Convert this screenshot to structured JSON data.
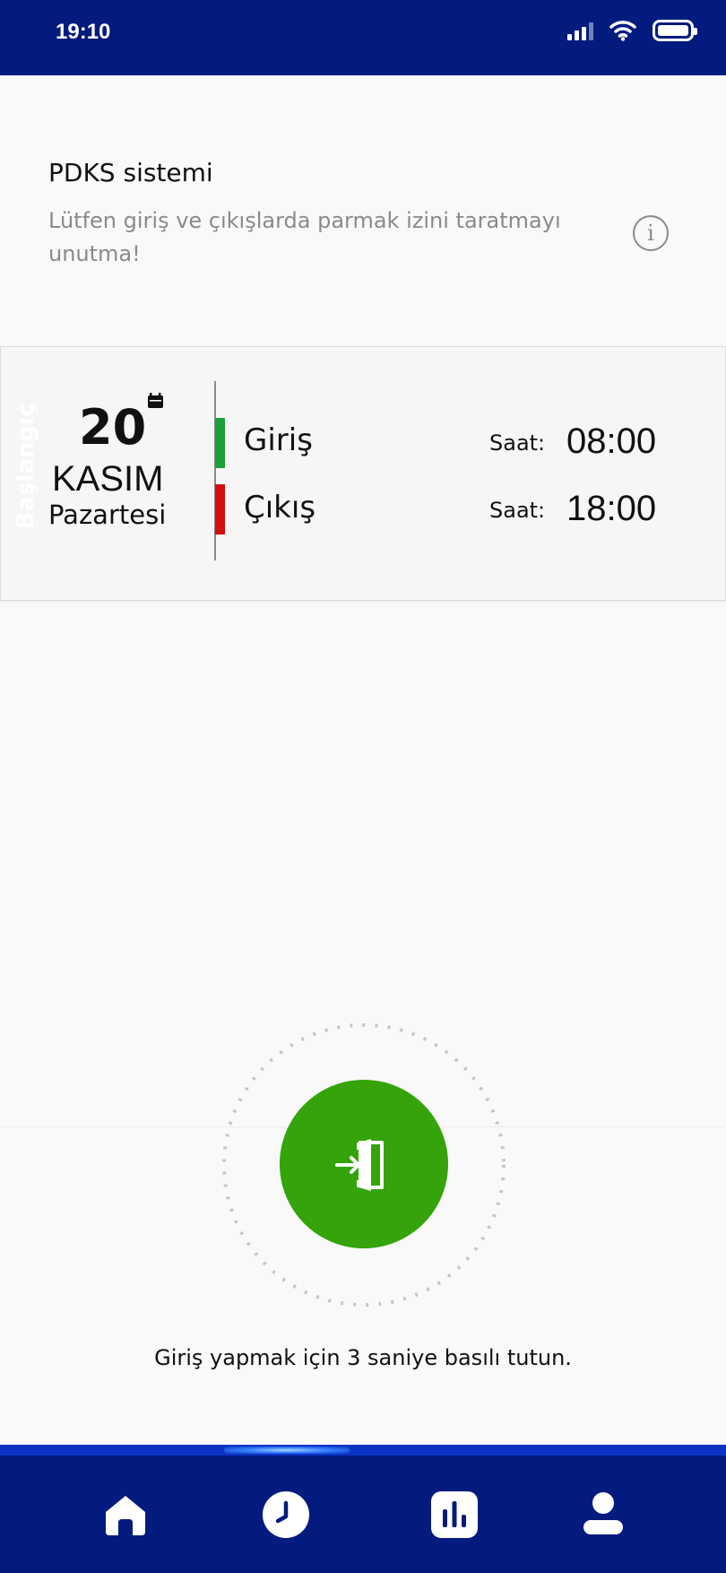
{
  "status_bar": {
    "time": "19:10"
  },
  "header": {
    "title": "PDKS sistemi",
    "subtitle": "Lütfen giriş ve çıkışlarda parmak izini taratmayı unutma!",
    "info_icon": "info-icon"
  },
  "card": {
    "vertical_label": "Başlangıç",
    "date": {
      "day": "20",
      "month": "KASIM",
      "weekday": "Pazartesi"
    },
    "rows": [
      {
        "label": "Giriş",
        "saat_label": "Saat:",
        "time": "08:00",
        "color": "#1aa23a"
      },
      {
        "label": "Çıkış",
        "saat_label": "Saat:",
        "time": "18:00",
        "color": "#d50e0e"
      }
    ]
  },
  "action": {
    "button_icon": "door-enter-icon",
    "button_color": "#34a40a",
    "instruction": "Giriş yapmak için 3 saniye basılı tutun."
  },
  "nav": {
    "background": "#031b7e",
    "items": [
      {
        "icon": "home-icon"
      },
      {
        "icon": "clock-icon"
      },
      {
        "icon": "chart-icon"
      },
      {
        "icon": "user-icon"
      }
    ]
  }
}
